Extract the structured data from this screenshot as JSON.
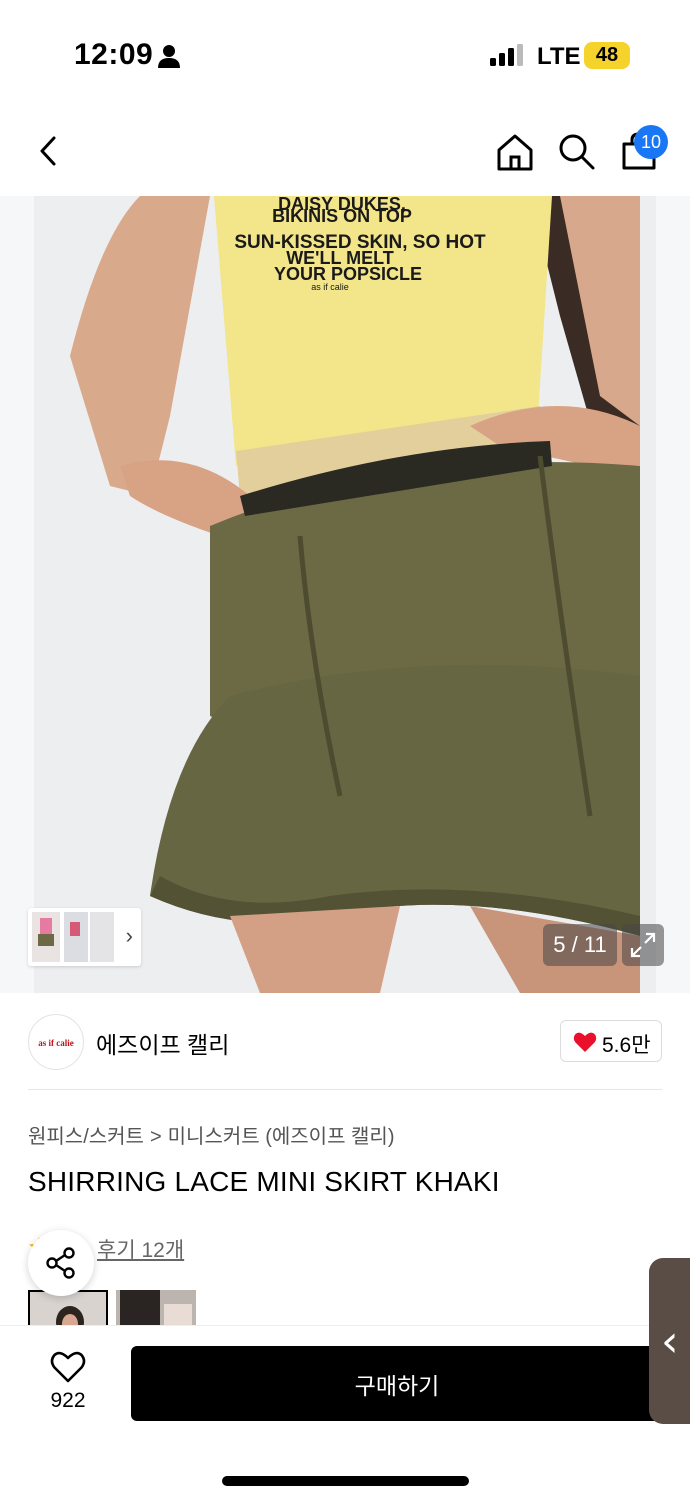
{
  "status_bar": {
    "time": "12:09",
    "network": "LTE",
    "battery": "48"
  },
  "nav": {
    "cart_badge": "10",
    "icons": [
      "back-icon",
      "home-icon",
      "search-icon",
      "shopping-bag-icon"
    ]
  },
  "hero": {
    "shirt_text": [
      "DAISY DUKES,",
      "BIKINIS ON TOP",
      "SUN-KISSED SKIN, SO HOT",
      "WE'LL MELT",
      "YOUR POPSICLE",
      "as if calie"
    ],
    "counter": "5 / 11"
  },
  "brand": {
    "logo_text": "as if calie",
    "name": "에즈이프 캘리",
    "likes": "5.6만"
  },
  "breadcrumb": {
    "category": "원피스/스커트",
    "separator": ">",
    "subcategory": "미니스커트 (에즈이프 캘리)"
  },
  "product": {
    "title": "SHIRRING LACE MINI SKIRT KHAKI",
    "reviews": "후기 12개"
  },
  "bottom": {
    "wish_count": "922",
    "buy_label": "구매하기",
    "side_tab": "‹"
  },
  "colors": {
    "accent_blue": "#1976f5",
    "heart_red": "#e8102a",
    "buy_button": "#000000",
    "skirt_khaki": "#6b6a45",
    "shirt_yellow": "#f3e58a"
  }
}
